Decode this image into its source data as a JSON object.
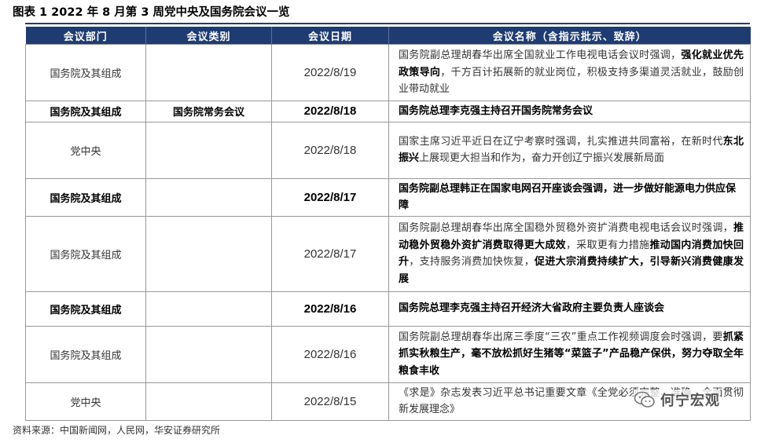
{
  "title": "图表 1  2022 年 8 月第 3 周党中央及国务院会议一览",
  "headers": [
    "会议部门",
    "会议类别",
    "会议日期",
    "会议名称（含指示批示、致辞）"
  ],
  "rows": [
    {
      "dept": "国务院及其组成",
      "category": "",
      "date": "2022/8/19",
      "segments": [
        {
          "t": "国务院副总理胡春华出席全国就业工作电视电话会议时强调，",
          "b": false
        },
        {
          "t": "强化就业优先政策导向",
          "b": true
        },
        {
          "t": "，千方百计拓展新的就业岗位，积极支持多渠道灵活就业，鼓励创业带动就业",
          "b": false
        }
      ]
    },
    {
      "dept": "国务院及其组成",
      "category": "国务院常务会议",
      "date": "2022/8/18",
      "segments": [
        {
          "t": "国务院总理李克强主持召开国务院常务会议",
          "b": true
        }
      ]
    },
    {
      "dept": "党中央",
      "category": "",
      "date": "2022/8/18",
      "segments": [
        {
          "t": "国家主席习近平近日在辽宁考察时强调，扎实推进共同富裕，在新时代",
          "b": false
        },
        {
          "t": "东北振兴",
          "b": true
        },
        {
          "t": "上展现更大担当和作为，奋力开创辽宁振兴发展新局面",
          "b": false
        }
      ]
    },
    {
      "dept": "国务院及其组成",
      "category": "",
      "date": "2022/8/17",
      "segments": [
        {
          "t": "国务院副总理韩正在国家电网召开座谈会强调，进一步做好能源电力供应保障",
          "b": true
        }
      ]
    },
    {
      "dept": "国务院及其组成",
      "category": "",
      "date": "2022/8/17",
      "segments": [
        {
          "t": "国务院副总理胡春华出席全国稳外贸稳外资扩消费电视电话会议时强调，",
          "b": false
        },
        {
          "t": "推动稳外贸稳外资扩消费取得更大成效",
          "b": true
        },
        {
          "t": "，采取更有力措施",
          "b": false
        },
        {
          "t": "推动国内消费加快回升",
          "b": true
        },
        {
          "t": "，支持服务消费加快恢复，",
          "b": false
        },
        {
          "t": "促进大宗消费持续扩大，引导新兴消费健康发展",
          "b": true
        }
      ]
    },
    {
      "dept": "国务院及其组成",
      "category": "",
      "date": "2022/8/16",
      "segments": [
        {
          "t": "国务院总理李克强主持召开经济大省政府主要负责人座谈会",
          "b": true
        }
      ]
    },
    {
      "dept": "国务院及其组成",
      "category": "",
      "date": "2022/8/16",
      "segments": [
        {
          "t": "国务院副总理胡春华出席三季度“三农”重点工作视频调度会时强调，要",
          "b": false
        },
        {
          "t": "抓紧抓实秋粮生产，毫不放松抓好生猪等“菜篮子”产品稳产保供，努力夺取全年粮食丰收",
          "b": true
        }
      ]
    },
    {
      "dept": "党中央",
      "category": "",
      "date": "2022/8/15",
      "segments": [
        {
          "t": "《求是》杂志发表习近平总书记重要文章《全党必须完整、准确、全面贯彻新发展理念》",
          "b": false
        }
      ]
    }
  ],
  "source": "资料来源：中国新闻网，人民网，华安证券研究所",
  "watermark": "何宁宏观",
  "colors": {
    "header_bg": "#1f3c72",
    "header_text": "#ffffff",
    "border": "#999999"
  }
}
